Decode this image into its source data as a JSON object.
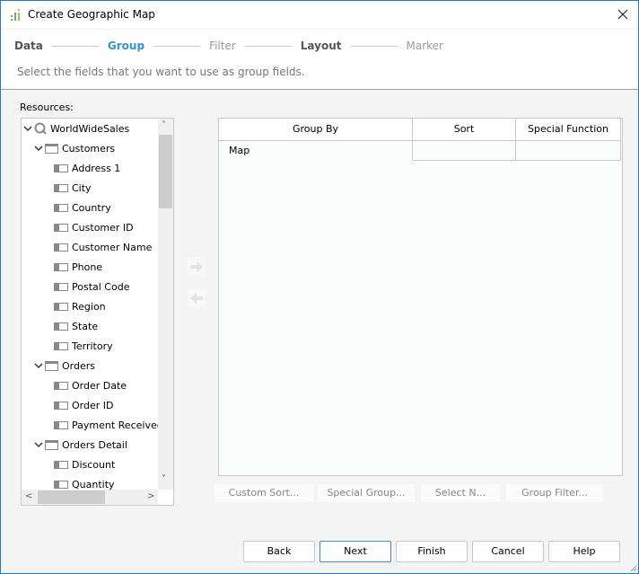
{
  "window": {
    "title": "Create Geographic Map",
    "app_icon": "chart-bars-icon",
    "close_icon": "close-icon"
  },
  "steps": [
    {
      "label": "Data",
      "state": "done"
    },
    {
      "label": "Group",
      "state": "active"
    },
    {
      "label": "Filter",
      "state": "disabled"
    },
    {
      "label": "Layout",
      "state": "done"
    },
    {
      "label": "Marker",
      "state": "disabled"
    }
  ],
  "instruction": "Select the fields that you want to use as group fields.",
  "resources": {
    "label": "Resources:",
    "tree": [
      {
        "label": "WorldWideSales",
        "type": "query",
        "level": 0,
        "expanded": true
      },
      {
        "label": "Customers",
        "type": "table",
        "level": 1,
        "expanded": true
      },
      {
        "label": "Address 1",
        "type": "field",
        "level": 2
      },
      {
        "label": "City",
        "type": "field",
        "level": 2
      },
      {
        "label": "Country",
        "type": "field",
        "level": 2
      },
      {
        "label": "Customer ID",
        "type": "field",
        "level": 2
      },
      {
        "label": "Customer Name",
        "type": "field",
        "level": 2
      },
      {
        "label": "Phone",
        "type": "field",
        "level": 2
      },
      {
        "label": "Postal Code",
        "type": "field",
        "level": 2
      },
      {
        "label": "Region",
        "type": "field",
        "level": 2
      },
      {
        "label": "State",
        "type": "field",
        "level": 2
      },
      {
        "label": "Territory",
        "type": "field",
        "level": 2
      },
      {
        "label": "Orders",
        "type": "table",
        "level": 1,
        "expanded": true
      },
      {
        "label": "Order Date",
        "type": "field",
        "level": 2
      },
      {
        "label": "Order ID",
        "type": "field",
        "level": 2
      },
      {
        "label": "Payment Received",
        "type": "field",
        "level": 2
      },
      {
        "label": "Orders Detail",
        "type": "table",
        "level": 1,
        "expanded": true
      },
      {
        "label": "Discount",
        "type": "field",
        "level": 2
      },
      {
        "label": "Quantity",
        "type": "field",
        "level": 2
      }
    ]
  },
  "move_buttons": {
    "add": "arrow-right-icon",
    "remove": "arrow-left-icon"
  },
  "group_table": {
    "columns": [
      "Group By",
      "Sort",
      "Special Function"
    ],
    "rows": [
      {
        "group_by": "Map",
        "sort": "",
        "special_function": ""
      }
    ]
  },
  "group_buttons": {
    "custom_sort": "Custom Sort...",
    "special_group": "Special Group...",
    "select_n": "Select N...",
    "group_filter": "Group Filter..."
  },
  "footer": {
    "back": "Back",
    "next": "Next",
    "finish": "Finish",
    "cancel": "Cancel",
    "help": "Help"
  }
}
